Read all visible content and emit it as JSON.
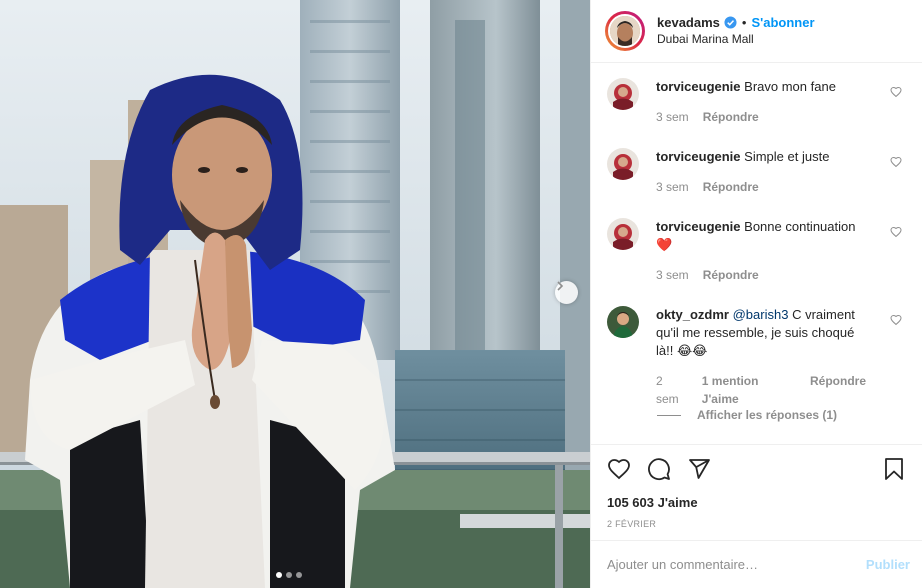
{
  "post": {
    "username": "kevadams",
    "follow_label": "S'abonner",
    "separator": "•",
    "location": "Dubai Marina Mall",
    "verified_icon": "verified-badge-icon"
  },
  "comments": [
    {
      "user": "torviceugenie",
      "text": "Bravo mon fane",
      "time": "3 sem",
      "reply": "Répondre"
    },
    {
      "user": "torviceugenie",
      "text": "Simple et juste",
      "time": "3 sem",
      "reply": "Répondre"
    },
    {
      "user": "torviceugenie",
      "text": "Bonne continuation",
      "emoji": "❤️",
      "time": "3 sem",
      "reply": "Répondre"
    },
    {
      "user": "okty_ozdmr",
      "mention": "@barish3",
      "text": "C vraiment qu'il me ressemble, je suis choqué là!!",
      "emoji": "😂😂",
      "time": "2 sem",
      "likes": "1 mention J'aime",
      "reply": "Répondre"
    }
  ],
  "view_replies": "Afficher les réponses (1)",
  "likes_label": "105 603 J'aime",
  "date_label": "2 février",
  "add_comment": {
    "placeholder": "Ajouter un commentaire…",
    "publish_label": "Publier"
  },
  "carousel": {
    "count": 3,
    "active": 0
  },
  "colors": {
    "link_blue": "#0095f6",
    "muted": "#8e8e8e",
    "publish_disabled": "#b2dffc"
  }
}
